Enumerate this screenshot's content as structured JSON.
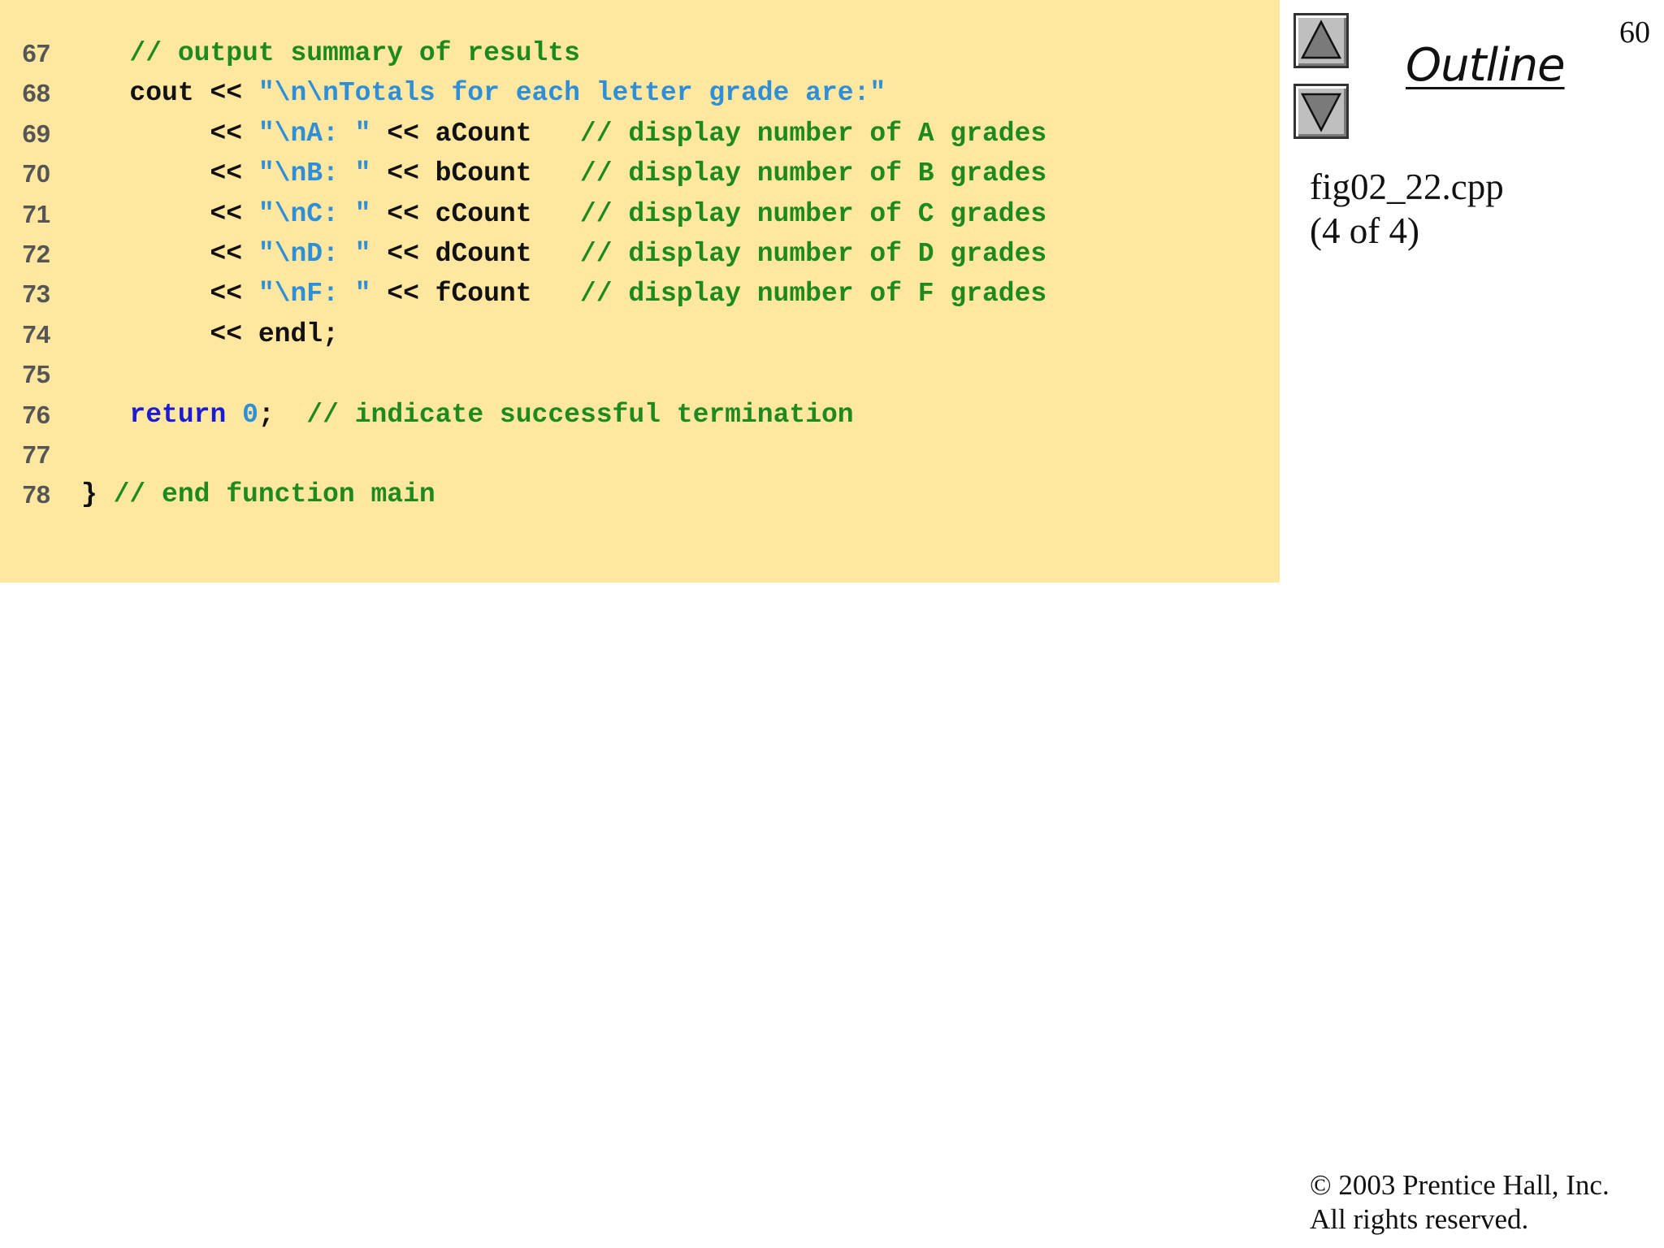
{
  "slide": {
    "page_number": "60",
    "outline_title": "Outline",
    "file_name": "fig02_22.cpp",
    "page_info": "(4 of 4)",
    "copyright_line1": "© 2003 Prentice Hall, Inc.",
    "copyright_line2": "All rights reserved."
  },
  "nav": {
    "up_icon": "triangle-up-icon",
    "down_icon": "triangle-down-icon"
  },
  "colors": {
    "code_background": "#ffe79f",
    "comment": "#1e8a1e",
    "string": "#2e8fd8",
    "keyword": "#1b1bd6",
    "plain": "#111111",
    "line_number": "#555555"
  },
  "code": {
    "lines": [
      {
        "number": "67",
        "tokens": [
          {
            "t": "   ",
            "k": "plain"
          },
          {
            "t": "// output summary of results",
            "k": "comment"
          }
        ]
      },
      {
        "number": "68",
        "tokens": [
          {
            "t": "   cout << ",
            "k": "plain"
          },
          {
            "t": "\"\\n\\nTotals for each letter grade are:\"",
            "k": "string"
          }
        ]
      },
      {
        "number": "69",
        "tokens": [
          {
            "t": "        << ",
            "k": "plain"
          },
          {
            "t": "\"\\nA: \"",
            "k": "string"
          },
          {
            "t": " << aCount   ",
            "k": "plain"
          },
          {
            "t": "// display number of A grades",
            "k": "comment"
          }
        ]
      },
      {
        "number": "70",
        "tokens": [
          {
            "t": "        << ",
            "k": "plain"
          },
          {
            "t": "\"\\nB: \"",
            "k": "string"
          },
          {
            "t": " << bCount   ",
            "k": "plain"
          },
          {
            "t": "// display number of B grades",
            "k": "comment"
          }
        ]
      },
      {
        "number": "71",
        "tokens": [
          {
            "t": "        << ",
            "k": "plain"
          },
          {
            "t": "\"\\nC: \"",
            "k": "string"
          },
          {
            "t": " << cCount   ",
            "k": "plain"
          },
          {
            "t": "// display number of C grades",
            "k": "comment"
          }
        ]
      },
      {
        "number": "72",
        "tokens": [
          {
            "t": "        << ",
            "k": "plain"
          },
          {
            "t": "\"\\nD: \"",
            "k": "string"
          },
          {
            "t": " << dCount   ",
            "k": "plain"
          },
          {
            "t": "// display number of D grades",
            "k": "comment"
          }
        ]
      },
      {
        "number": "73",
        "tokens": [
          {
            "t": "        << ",
            "k": "plain"
          },
          {
            "t": "\"\\nF: \"",
            "k": "string"
          },
          {
            "t": " << fCount   ",
            "k": "plain"
          },
          {
            "t": "// display number of F grades",
            "k": "comment"
          }
        ]
      },
      {
        "number": "74",
        "tokens": [
          {
            "t": "        << endl;",
            "k": "plain"
          }
        ]
      },
      {
        "number": "75",
        "tokens": []
      },
      {
        "number": "76",
        "tokens": [
          {
            "t": "   ",
            "k": "plain"
          },
          {
            "t": "return",
            "k": "keyword"
          },
          {
            "t": " ",
            "k": "plain"
          },
          {
            "t": "0",
            "k": "number"
          },
          {
            "t": ";  ",
            "k": "plain"
          },
          {
            "t": "// indicate successful termination",
            "k": "comment"
          }
        ]
      },
      {
        "number": "77",
        "tokens": []
      },
      {
        "number": "78",
        "tokens": [
          {
            "t": "} ",
            "k": "plain"
          },
          {
            "t": "// end function main",
            "k": "comment"
          }
        ]
      }
    ]
  }
}
